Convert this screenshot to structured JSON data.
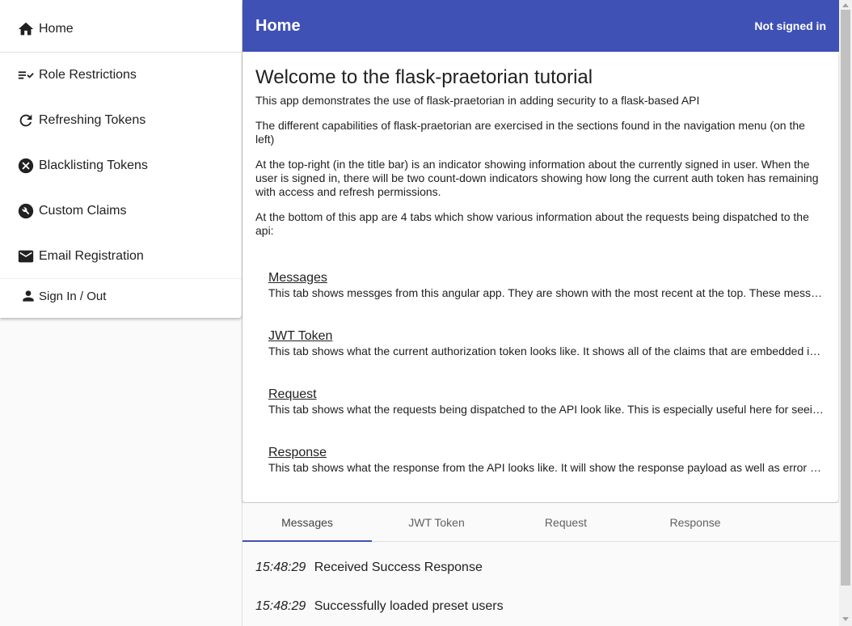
{
  "sidebar": {
    "items": [
      {
        "label": "Home",
        "icon": "home-icon"
      },
      {
        "label": "Role Restrictions",
        "icon": "checklist-icon"
      },
      {
        "label": "Refreshing Tokens",
        "icon": "refresh-icon"
      },
      {
        "label": "Blacklisting Tokens",
        "icon": "cancel-icon"
      },
      {
        "label": "Custom Claims",
        "icon": "wrench-icon"
      },
      {
        "label": "Email Registration",
        "icon": "mail-icon"
      }
    ],
    "signin": {
      "label": "Sign In / Out",
      "icon": "person-icon"
    }
  },
  "header": {
    "title": "Home",
    "status": "Not signed in",
    "color": "#3f51b5"
  },
  "main": {
    "heading": "Welcome to the flask-praetorian tutorial",
    "paragraphs": [
      "This app demonstrates the use of flask-praetorian in adding security to a flask-based API",
      "The different capabilities of flask-praetorian are exercised in the sections found in the navigation menu (on the left)",
      "At the top-right (in the title bar) is an indicator showing information about the currently signed in user. When the user is signed in, there will be two count-down indicators showing how long the current auth token has remaining with access and refresh permissions.",
      "At the bottom of this app are 4 tabs which show various information about the requests being dispatched to the api:"
    ],
    "tab_descriptions": [
      {
        "name": "Messages",
        "desc": "This tab shows messges from this angular app. They are shown with the most recent at the top. These messages are useful for seeing what the app is doing"
      },
      {
        "name": "JWT Token",
        "desc": "This tab shows what the current authorization token looks like. It shows all of the claims that are embedded in the token"
      },
      {
        "name": "Request",
        "desc": "This tab shows what the requests being dispatched to the API look like. This is especially useful here for seeing how the token is packaged"
      },
      {
        "name": "Response",
        "desc": "This tab shows what the response from the API looks like. It will show the response payload as well as error messages"
      }
    ]
  },
  "tabs": {
    "items": [
      "Messages",
      "JWT Token",
      "Request",
      "Response"
    ],
    "active": "Messages"
  },
  "messages": [
    {
      "time": "15:48:29",
      "text": "Received Success Response"
    },
    {
      "time": "15:48:29",
      "text": "Successfully loaded preset users"
    }
  ]
}
